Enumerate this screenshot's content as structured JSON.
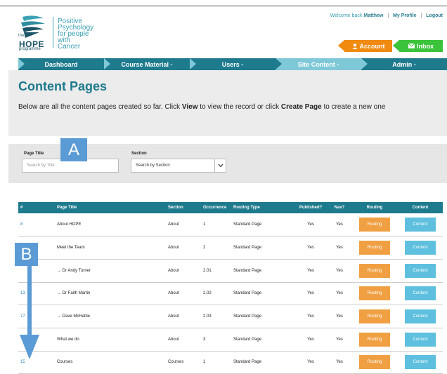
{
  "logo": {
    "text_lines": [
      "Positive",
      "Psychology",
      "for people",
      "with",
      "Cancer"
    ],
    "small": "the",
    "hope": "HOPE",
    "programme": "programme"
  },
  "header": {
    "welcome_prefix": "Welcome back",
    "user": "Matthew",
    "sep": "|",
    "my_profile": "My Profile",
    "logout": "Logout",
    "account_label": "Account",
    "inbox_label": "Inbox"
  },
  "colors": {
    "primary": "#1e7a8d",
    "nav_active": "#7fc8d8",
    "account": "#f08a10",
    "inbox": "#3cc33c",
    "routing": "#f0a043",
    "content": "#5ec0de",
    "callout": "#5b9bd5"
  },
  "nav": [
    {
      "label": "Dashboard"
    },
    {
      "label": "Course Material -"
    },
    {
      "label": "Users -"
    },
    {
      "label": "Site Content -"
    },
    {
      "label": "Admin -"
    }
  ],
  "page": {
    "title": "Content Pages",
    "desc_1": "Below are all the content pages created so far. Click ",
    "desc_view": "View",
    "desc_2": " to view the record or click ",
    "desc_create": "Create Page",
    "desc_3": " to create a new one"
  },
  "filters": {
    "title_label": "Page Title",
    "title_placeholder": "Search by Title",
    "section_label": "Section",
    "section_value": "Search by Section"
  },
  "callouts": {
    "a": "A",
    "b": "B"
  },
  "table": {
    "headers": [
      "#",
      "Page Title",
      "Section",
      "Occurrence",
      "Routing Type",
      "Published?",
      "Nav?",
      "Routing",
      "Content"
    ],
    "rows": [
      {
        "id": "8",
        "title": "About HOPE",
        "section": "About",
        "occ": "1",
        "type": "Standard Page",
        "pub": "Yes",
        "nav": "Yes"
      },
      {
        "id": "",
        "title": "Meet the Team",
        "section": "About",
        "occ": "2",
        "type": "Standard Page",
        "pub": "Yes",
        "nav": "Yes"
      },
      {
        "id": "",
        "title": "→ Dr Andy Turner",
        "section": "About",
        "occ": "2.01",
        "type": "Standard Page",
        "pub": "Yes",
        "nav": "Yes"
      },
      {
        "id": "13",
        "title": "→ Dr Faith Martin",
        "section": "About",
        "occ": "2.02",
        "type": "Standard Page",
        "pub": "Yes",
        "nav": "Yes"
      },
      {
        "id": "77",
        "title": "→ Dave McHattie",
        "section": "About",
        "occ": "2.03",
        "type": "Standard Page",
        "pub": "Yes",
        "nav": "Yes"
      },
      {
        "id": "",
        "title": "What we do",
        "section": "About",
        "occ": "3",
        "type": "Standard Page",
        "pub": "Yes",
        "nav": "Yes"
      },
      {
        "id": "15",
        "title": "Courses",
        "section": "Courses",
        "occ": "1",
        "type": "Standard Page",
        "pub": "Yes",
        "nav": "Yes"
      }
    ],
    "routing_label": "Routing",
    "content_label": "Content"
  },
  "icons": [
    "user-icon",
    "envelope-icon",
    "chevron-down-icon",
    "arrow-down-icon"
  ]
}
